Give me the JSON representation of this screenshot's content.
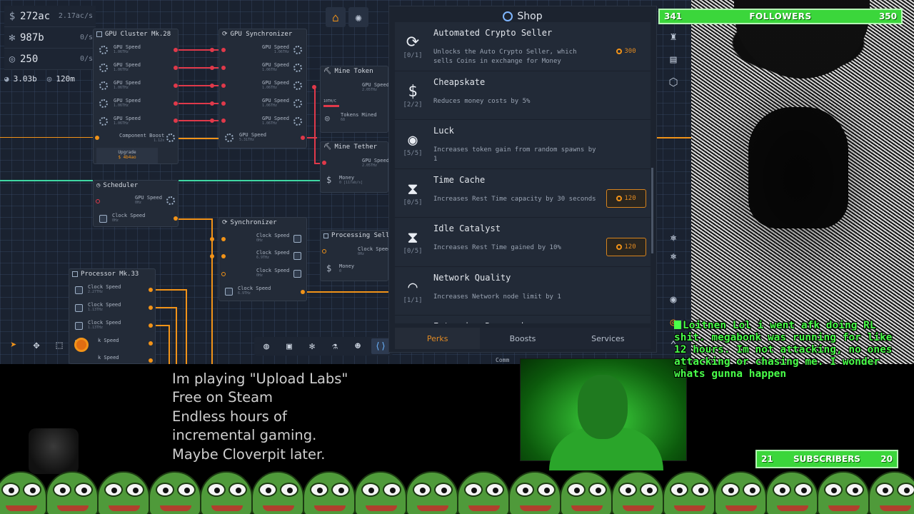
{
  "stats": {
    "currency": {
      "value": "272ac",
      "rate": "2.17ac/s",
      "icon": "dollar-icon"
    },
    "compute": {
      "value": "987b",
      "rate": "0/s",
      "icon": "gear-icon"
    },
    "tokens": {
      "value": "250",
      "rate": "0/s",
      "icon": "token-icon"
    },
    "extra_a": "3.03b",
    "extra_b": "120m"
  },
  "nodes": {
    "gpu_cluster": {
      "title": "GPU Cluster Mk.28",
      "row_label": "GPU Speed",
      "row_value": "1.06THz",
      "boost_label": "Component Boost",
      "boost_value": "1.12x",
      "upgrade_label": "Upgrade",
      "upgrade_cost": "$ 4b4ao"
    },
    "gpu_sync": {
      "title": "GPU Synchronizer",
      "row_label": "GPU Speed",
      "row_value": "1.06THz",
      "out_label": "GPU Speed",
      "out_value": "5.31THz"
    },
    "mine_token": {
      "title": "Mine Token",
      "speed_label": "GPU Speed",
      "speed_value": "2.05THz",
      "tokens_label": "Tokens Mined",
      "tokens_value": "68",
      "progress_label": "10TH/C"
    },
    "mine_tether": {
      "title": "Mine Tether",
      "speed_label": "GPU Speed",
      "speed_value": "2.05THz",
      "money_label": "Money",
      "money_value": "0 [117ab/s]"
    },
    "scheduler": {
      "title": "Scheduler",
      "gpu_label": "GPU Speed",
      "gpu_value": "0Hz",
      "clock_label": "Clock Speed",
      "clock_value": "0Hz"
    },
    "synchronizer": {
      "title": "Synchronizer",
      "row_label": "Clock Speed",
      "row_values": [
        "0Hz",
        "6.9THz",
        "0Hz"
      ],
      "out_label": "Clock Speed",
      "out_value": "6.9THz"
    },
    "processing_seller": {
      "title": "Processing Seller",
      "clock_label": "Clock Speed",
      "clock_value": "0Hz",
      "money_label": "Money",
      "money_value": "0"
    },
    "processor": {
      "title": "Processor Mk.33",
      "rows": [
        {
          "label": "Clock Speed",
          "value": "2.27THz"
        },
        {
          "label": "Clock Speed",
          "value": "1.13THz"
        },
        {
          "label": "Clock Speed",
          "value": "1.13THz"
        },
        {
          "label": "k Speed",
          "value": ""
        },
        {
          "label": "k Speed",
          "value": ""
        }
      ]
    },
    "commit": "Comm"
  },
  "shop": {
    "title": "Shop",
    "perks": [
      {
        "name": "Automated Crypto Seller",
        "desc": "Unlocks the Auto Crypto Seller, which sells Coins in exchange for Money",
        "level": "[0/1]",
        "cost": "300",
        "boxed": false,
        "icon": "crypto-seller-icon",
        "glyph": "⟳"
      },
      {
        "name": "Cheapskate",
        "desc": "Reduces money costs by 5%",
        "level": "[2/2]",
        "cost": "",
        "boxed": false,
        "icon": "dollar-icon",
        "glyph": "$"
      },
      {
        "name": "Luck",
        "desc": "Increases token gain from random spawns by 1",
        "level": "[5/5]",
        "cost": "",
        "boxed": false,
        "icon": "token-icon",
        "glyph": "◉"
      },
      {
        "name": "Time Cache",
        "desc": "Increases Rest Time capacity by 30 seconds",
        "level": "[0/5]",
        "cost": "120",
        "boxed": true,
        "icon": "hourglass-icon",
        "glyph": "⧗"
      },
      {
        "name": "Idle Catalyst",
        "desc": "Increases Rest Time gained by 10%",
        "level": "[0/5]",
        "cost": "120",
        "boxed": true,
        "icon": "hourglass-icon",
        "glyph": "⧗"
      },
      {
        "name": "Network Quality",
        "desc": "Increases Network node limit by 1",
        "level": "[1/1]",
        "cost": "",
        "boxed": false,
        "icon": "wifi-icon",
        "glyph": "◠"
      },
      {
        "name": "Extensive Research",
        "desc": "",
        "level": "",
        "cost": "",
        "boxed": false,
        "icon": "research-icon",
        "glyph": ""
      }
    ],
    "tabs": [
      "Perks",
      "Boosts",
      "Services"
    ]
  },
  "overlay": {
    "followers": {
      "left": "341",
      "label": "FOLLOWERS",
      "right": "350"
    },
    "subscribers": {
      "left": "21",
      "label": "SUBSCRIBERS",
      "right": "20"
    },
    "chat": {
      "user": "Loitnen",
      "message": "Lol i went afk doing RL shit. megabonk was running for like 12 hours. Im not attacking, no ones attacking or chasing me. I wonder whats gunna happen"
    },
    "promo": "Im playing \"Upload Labs\"\nFree on Steam\nEndless hours of\nincremental gaming.\nMaybe Cloverpit later."
  },
  "colors": {
    "accent": "#f29318",
    "wire_red": "#e0394a",
    "wire_green": "#3fd7a3",
    "panel": "#1c232f",
    "overlay_green": "#3bd63b",
    "chat_green": "#49ff49"
  }
}
